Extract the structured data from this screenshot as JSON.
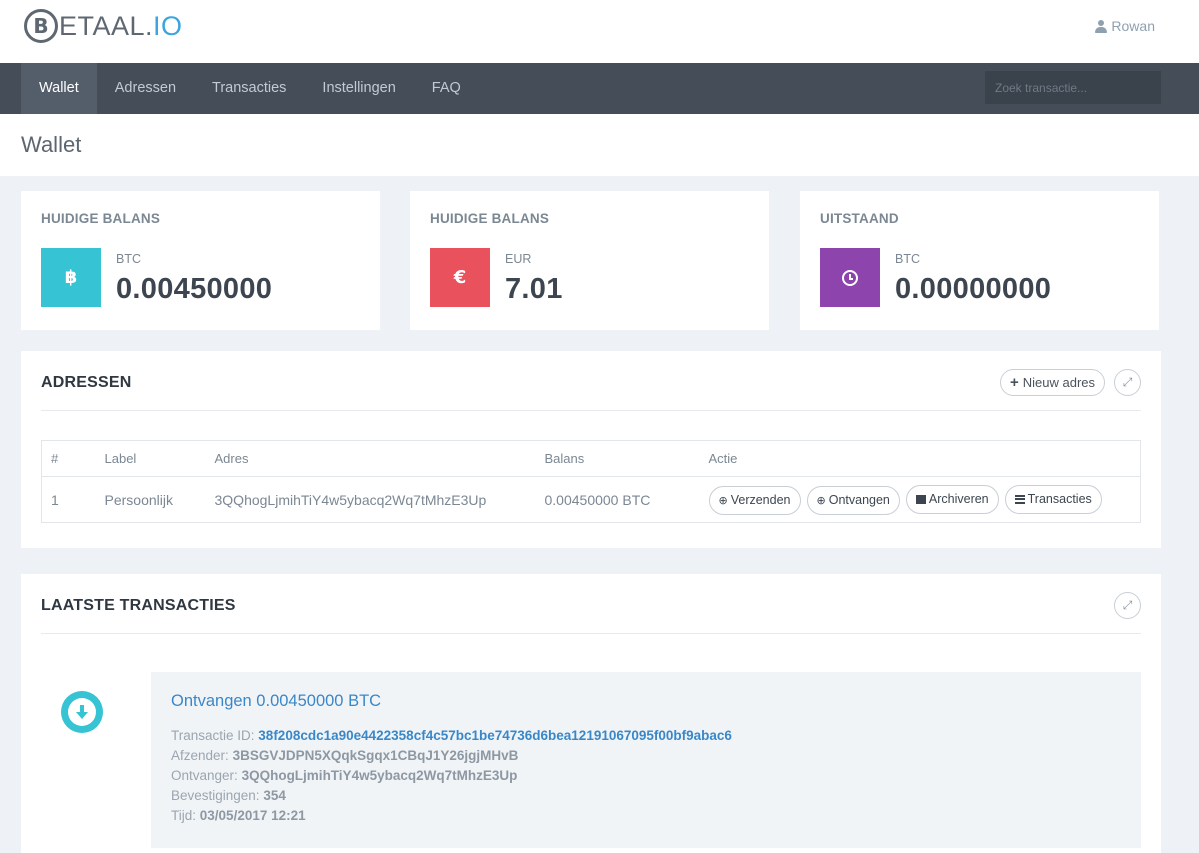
{
  "header": {
    "logo_letter": "B",
    "logo_text": "ETAAL.",
    "logo_suffix": "IO",
    "user_name": "Rowan"
  },
  "nav": {
    "items": [
      {
        "label": "Wallet",
        "active": true
      },
      {
        "label": "Adressen",
        "active": false
      },
      {
        "label": "Transacties",
        "active": false
      },
      {
        "label": "Instellingen",
        "active": false
      },
      {
        "label": "FAQ",
        "active": false
      }
    ],
    "search_placeholder": "Zoek transactie..."
  },
  "page": {
    "title": "Wallet"
  },
  "stats": [
    {
      "label": "HUIDIGE BALANS",
      "unit": "BTC",
      "value": "0.00450000",
      "icon": "bitcoin-icon",
      "color": "#36c3d3"
    },
    {
      "label": "HUIDIGE BALANS",
      "unit": "EUR",
      "value": "7.01",
      "icon": "euro-icon",
      "color": "#e9515c"
    },
    {
      "label": "UITSTAAND",
      "unit": "BTC",
      "value": "0.00000000",
      "icon": "clock-icon",
      "color": "#8e44ad"
    }
  ],
  "addresses": {
    "title": "ADRESSEN",
    "new_button": "Nieuw adres",
    "columns": [
      "#",
      "Label",
      "Adres",
      "Balans",
      "Actie"
    ],
    "rows": [
      {
        "index": "1",
        "label": "Persoonlijk",
        "address": "3QQhogLjmihTiY4w5ybacq2Wq7tMhzE3Up",
        "balance": "0.00450000 BTC"
      }
    ],
    "actions": [
      "Verzenden",
      "Ontvangen",
      "Archiveren",
      "Transacties"
    ]
  },
  "transactions": {
    "title": "LAATSTE TRANSACTIES",
    "items": [
      {
        "title": "Ontvangen 0.00450000 BTC",
        "id_label": "Transactie ID:",
        "id": "38f208cdc1a90e4422358cf4c57bc1be74736d6bea12191067095f00bf9abac6",
        "sender_label": "Afzender:",
        "sender": "3BSGVJDPN5XQqkSgqx1CBqJ1Y26jgjMHvB",
        "receiver_label": "Ontvanger:",
        "receiver": "3QQhogLjmihTiY4w5ybacq2Wq7tMhzE3Up",
        "confirmations_label": "Bevestigingen:",
        "confirmations": "354",
        "time_label": "Tijd:",
        "time": "03/05/2017 12:21"
      }
    ]
  }
}
